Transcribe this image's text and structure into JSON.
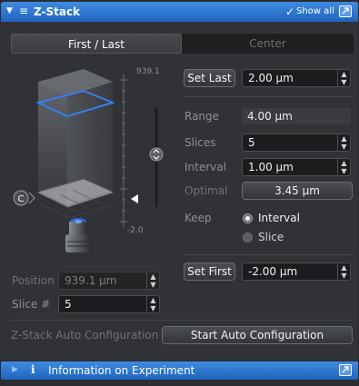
{
  "header": {
    "title": "Z-Stack",
    "show_all": "Show all"
  },
  "tabs": [
    {
      "label": "First / Last",
      "active": true
    },
    {
      "label": "Center",
      "active": false
    }
  ],
  "scale": {
    "top": "939.1",
    "bottom": "-2.0"
  },
  "set_last": {
    "button": "Set Last",
    "value": "2.00 µm"
  },
  "range": {
    "label": "Range",
    "value": "4.00 µm"
  },
  "slices": {
    "label": "Slices",
    "value": "5"
  },
  "interval": {
    "label": "Interval",
    "value": "1.00 µm"
  },
  "optimal": {
    "label": "Optimal",
    "value": "3.45 µm"
  },
  "keep": {
    "label": "Keep",
    "options": [
      {
        "label": "Interval",
        "selected": true
      },
      {
        "label": "Slice",
        "selected": false
      }
    ]
  },
  "set_first": {
    "button": "Set First",
    "value": "-2.00 µm"
  },
  "position": {
    "label": "Position",
    "value": "939.1 µm"
  },
  "slice_num": {
    "label": "Slice #",
    "value": "5"
  },
  "auto": {
    "label": "Z-Stack Auto Configuration",
    "button": "Start Auto Configuration"
  },
  "footer": {
    "title": "Information on Experiment"
  },
  "colors": {
    "accent": "#2e7ad6",
    "header_blue": "#1f64bf",
    "focus_blue": "#3a7cf0"
  }
}
